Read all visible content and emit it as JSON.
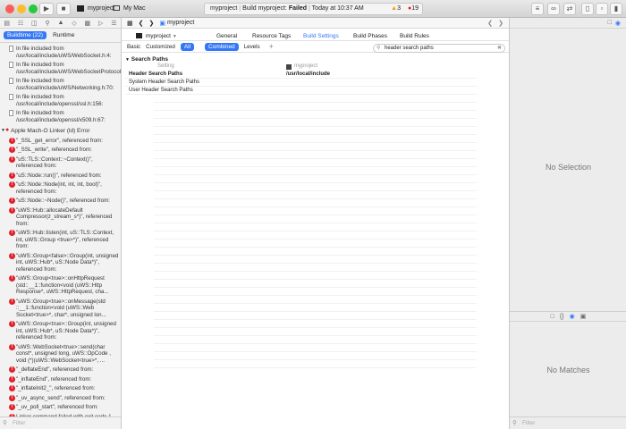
{
  "titlebar": {
    "project": "myproject",
    "destination": "My Mac",
    "activity_project": "myproject",
    "activity_status_prefix": "Build myproject: ",
    "activity_status": "Failed",
    "activity_time": "Today at 10:37 AM",
    "warning_count": "3",
    "error_count": "19"
  },
  "navigator": {
    "tabs": [
      "Buildtime (22)",
      "Runtime"
    ],
    "filter_placeholder": "Filter",
    "notes": [
      "In file included from /usr/local/include/uWS/WebSocket.h:4:",
      "In file included from /usr/local/include/uWS/WebSocketProtocol.h:5:",
      "In file included from /usr/local/include/uWS/Networking.h:70:",
      "In file included from /usr/local/include/openssl/ssl.h:156:",
      "In file included from /usr/local/include/openssl/x509.h:67:"
    ],
    "group": "Apple Mach-O Linker (ld) Error",
    "errors": [
      "\"_SSL_get_error\", referenced from:",
      "\"_SSL_write\", referenced from:",
      "\"uS::TLS::Context::~Context()\", referenced from:",
      "\"uS::Node::run()\", referenced from:",
      "\"uS::Node::Node(int, int, int, bool)\", referenced from:",
      "\"uS::Node::~Node()\", referenced from:",
      "\"uWS::Hub::allocateDefault Compressor(z_stream_s*)\", referenced from:",
      "\"uWS::Hub::listen(int, uS::TLS::Context, int, uWS::Group <true>*)\", referenced from:",
      "\"uWS::Group<false>::Group(int, unsigned int, uWS::Hub*, uS::Node Data*)\", referenced from:",
      "\"uWS::Group<true>::onHttpRequest (std::__1::function<void (uWS::Http Response*, uWS::HttpRequest, cha...",
      "\"uWS::Group<true>::onMessage(std ::__1::function<void (uWS::Web Socket<true>*, char*, unsigned lon...",
      "\"uWS::Group<true>::Group(int, unsigned int, uWS::Hub*, uS::Node Data*)\", referenced from:",
      "\"uWS::WebSocket<true>::send(char const*, unsigned long, uWS::OpCode , void (*)(uWS::WebSocket<true>*, ...",
      "\"_deflateEnd\", referenced from:",
      "\"_inflateEnd\", referenced from:",
      "\"_inflateInit2_\", referenced from:",
      "\"_uv_async_send\", referenced from:",
      "\"_uv_poll_start\", referenced from:",
      "Linker command failed with exit code 1 (use -v to see invocation)"
    ]
  },
  "editor": {
    "breadcrumb": "myproject",
    "target": "myproject",
    "tabs": [
      "General",
      "Resource Tags",
      "Build Settings",
      "Build Phases",
      "Build Rules"
    ],
    "active_tab": "Build Settings",
    "scope": [
      "Basic",
      "Customized",
      "All",
      "Combined",
      "Levels"
    ],
    "search_value": "header search paths",
    "section_title": "Search Paths",
    "column_setting": "Setting",
    "column_target": "myproject",
    "rows": [
      {
        "name": "Header Search Paths",
        "value": "/usr/local/include"
      },
      {
        "name": "System Header Search Paths",
        "value": ""
      },
      {
        "name": "User Header Search Paths",
        "value": ""
      }
    ]
  },
  "inspector": {
    "no_selection": "No Selection",
    "no_matches": "No Matches",
    "filter_placeholder": "Filter"
  }
}
